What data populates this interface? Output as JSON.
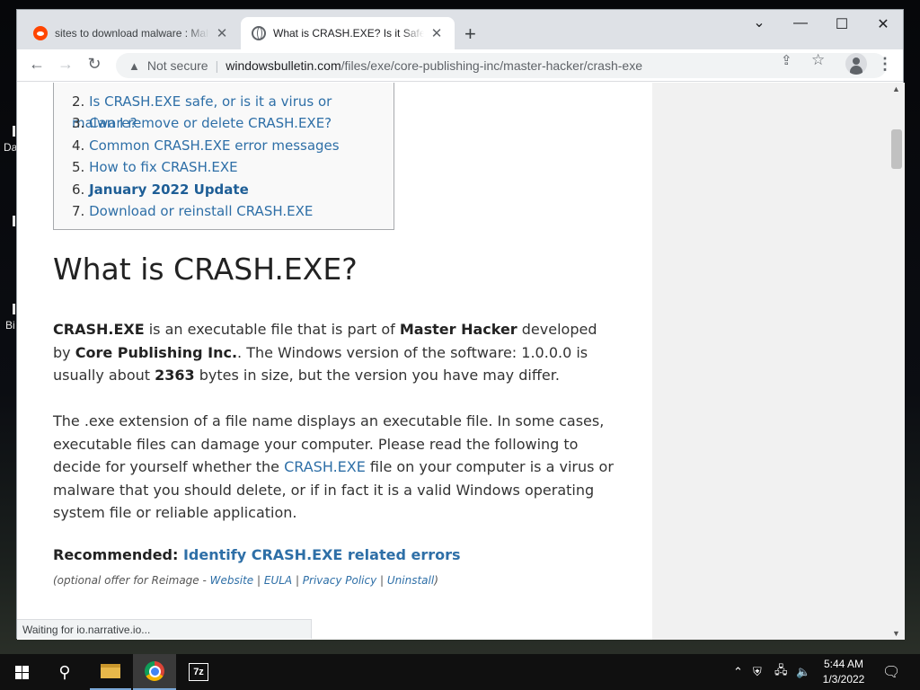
{
  "desktop": {
    "labels": [
      "Da",
      "Bi"
    ]
  },
  "browser": {
    "tabs": [
      {
        "title": "sites to download malware : Malware",
        "icon": "reddit-icon",
        "active": false
      },
      {
        "title": "What is CRASH.EXE? Is it Safe or a Virus?",
        "icon": "globe-icon",
        "active": true
      }
    ],
    "window_controls": {
      "dropdown": "⌄",
      "minimize": "—",
      "maximize": "☐",
      "close": "✕"
    },
    "toolbar": {
      "security_label": "Not secure",
      "url_domain": "windowsbulletin.com",
      "url_path": "/files/exe/core-publishing-inc/master-hacker/crash-exe"
    },
    "status_text": "Waiting for io.narrative.io..."
  },
  "article": {
    "toc": [
      {
        "num": "2.",
        "text": "Is CRASH.EXE safe, or is it a virus or malware?",
        "bold": false
      },
      {
        "num": "3.",
        "text": "Can I remove or delete CRASH.EXE?",
        "bold": false
      },
      {
        "num": "4.",
        "text": "Common CRASH.EXE error messages",
        "bold": false
      },
      {
        "num": "5.",
        "text": "How to fix CRASH.EXE",
        "bold": false
      },
      {
        "num": "6.",
        "text": "January 2022 Update",
        "bold": true
      },
      {
        "num": "7.",
        "text": "Download or reinstall CRASH.EXE",
        "bold": false
      }
    ],
    "heading": "What is CRASH.EXE?",
    "para1": {
      "b1": "CRASH.EXE",
      "t1": " is an executable file that is part of ",
      "b2": "Master Hacker",
      "t2": " developed by ",
      "b3": "Core Publishing Inc.",
      "t3": ". The Windows version of the software: 1.0.0.0 is usually about ",
      "b4": "2363",
      "t4": " bytes in size, but the version you have may differ."
    },
    "para2": {
      "t1": "The .exe extension of a file name displays an executable file. In some cases, executable files can damage your computer. Please read the following to decide for yourself whether the ",
      "link": "CRASH.EXE",
      "t2": " file on your computer is a virus or malware that you should delete, or if in fact it is a valid Windows operating system file or reliable application."
    },
    "recommended": {
      "label": "Recommended:",
      "link": "Identify CRASH.EXE related errors"
    },
    "optional": {
      "prefix": "(optional offer for Reimage - ",
      "links": [
        "Website",
        "EULA",
        "Privacy Policy",
        "Uninstall"
      ],
      "separator": " | ",
      "suffix": ")"
    }
  },
  "taskbar": {
    "apps": [
      "file-explorer-icon",
      "chrome-icon",
      "7zip-icon"
    ],
    "z7_label": "7z",
    "clock": {
      "time": "5:44 AM",
      "date": "1/3/2022"
    }
  }
}
